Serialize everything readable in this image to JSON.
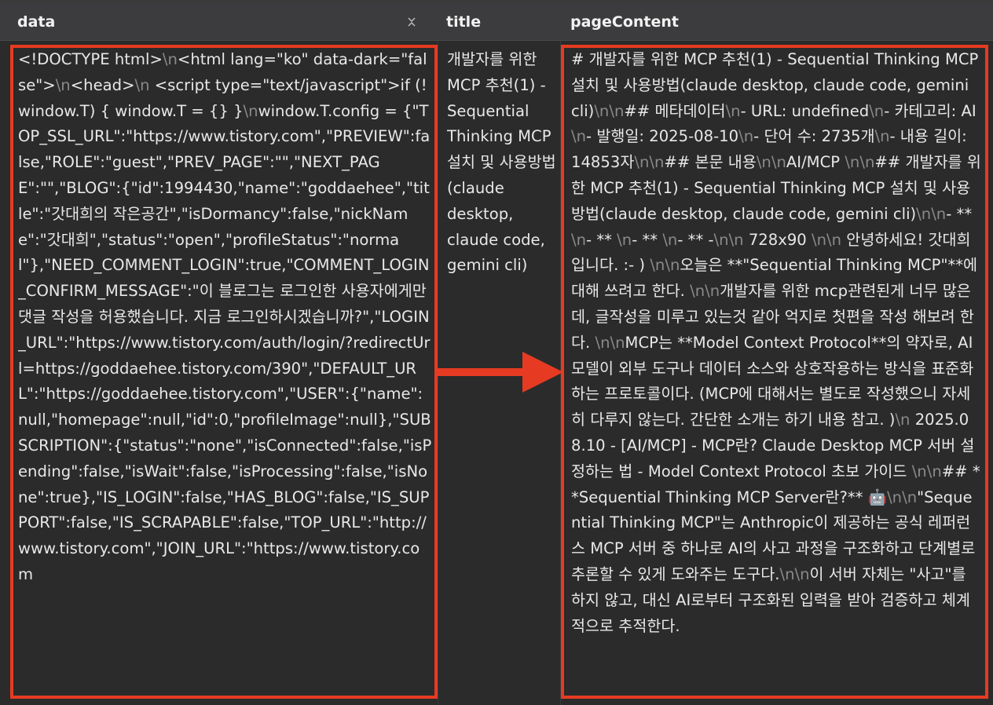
{
  "columns": {
    "data": "data",
    "title": "title",
    "page_content": "pageContent"
  },
  "colors": {
    "highlight": "#e63b22",
    "background": "#2b2b2b",
    "header": "#3c3c3e"
  },
  "row": {
    "title": "개발자를 위한 MCP 추천(1) - Sequential Thinking MCP 설치 및 사용방법(claude desktop, claude code, gemini cli)",
    "data_segments": [
      "<!DOCTYPE html>",
      "<html lang=\"ko\" data-dark=\"false\">",
      "<head>",
      "                <script type=\"text/javascript\">if (!window.T) { window.T = {} }",
      "window.T.config = {\"TOP_SSL_URL\":\"https://www.tistory.com\",\"PREVIEW\":false,\"ROLE\":\"guest\",\"PREV_PAGE\":\"\",\"NEXT_PAGE\":\"\",\"BLOG\":{\"id\":1994430,\"name\":\"goddaehee\",\"title\":\"갓대희의 작은공간\",\"isDormancy\":false,\"nickName\":\"갓대희\",\"status\":\"open\",\"profileStatus\":\"normal\"},\"NEED_COMMENT_LOGIN\":true,\"COMMENT_LOGIN_CONFIRM_MESSAGE\":\"이 블로그는 로그인한 사용자에게만 댓글 작성을 허용했습니다. 지금 로그인하시겠습니까?\",\"LOGIN_URL\":\"https://www.tistory.com/auth/login/?redirectUrl=https://goddaehee.tistory.com/390\",\"DEFAULT_URL\":\"https://goddaehee.tistory.com\",\"USER\":{\"name\":null,\"homepage\":null,\"id\":0,\"profileImage\":null},\"SUBSCRIPTION\":{\"status\":\"none\",\"isConnected\":false,\"isPending\":false,\"isWait\":false,\"isProcessing\":false,\"isNone\":true},\"IS_LOGIN\":false,\"HAS_BLOG\":false,\"IS_SUPPORT\":false,\"IS_SCRAPABLE\":false,\"TOP_URL\":\"http://www.tistory.com\",\"JOIN_URL\":\"https://www.tistory.com"
    ],
    "page_segments": [
      "# 개발자를 위한 MCP 추천(1) - Sequential Thinking MCP 설치 및 사용방법(claude desktop, claude code, gemini cli)",
      "",
      "## 메타데이터",
      "- URL: undefined",
      "- 카테고리: AI",
      "- 발행일: 2025-08-10",
      "- 단어 수: 2735개",
      "- 내용 길이: 14853자",
      "",
      "## 본문 내용",
      "",
      "AI/MCP ",
      "",
      "## 개발자를 위한 MCP 추천(1) - Sequential Thinking MCP 설치 및 사용방법(claude desktop, claude code, gemini cli)",
      "",
      "- ** ",
      "- ** ",
      "- ** ",
      "- ** -",
      "",
      " 728x90 ",
      "",
      " 안녕하세요! 갓대희 입니다. :- ) ",
      "",
      "오늘은 **\"Sequential Thinking MCP\"**에 대해 쓰려고 한다. ",
      "",
      "개발자를 위한 mcp관련된게 너무 많은데, 글작성을 미루고 있는것 같아 억지로 첫편을 작성 해보려 한다. ",
      "",
      "MCP는 **Model Context Protocol**의 약자로, AI 모델이 외부 도구나 데이터 소스와 상호작용하는 방식을 표준화하는 프로토콜이다. (MCP에 대해서는 별도로 작성했으니 자세히 다루지 않는다. 간단한 소개는 하기 내용 참고. )",
      " 2025.08.10 - [AI/MCP] - MCP란? Claude Desktop MCP 서버 설정하는 법 - Model Context Protocol 초보 가이드 ",
      "",
      "## **Sequential Thinking MCP Server란?** 🤖",
      "",
      "\"Sequential Thinking MCP\"는 Anthropic이 제공하는 공식 레퍼런스 MCP 서버 중 하나로 AI의 사고 과정을 구조화하고 단계별로 추론할 수 있게 도와주는 도구다.",
      "",
      "이 서버 자체는 \"사고\"를 하지 않고, 대신 AI로부터 구조화된 입력을 받아 검증하고 체계적으로 추적한다."
    ]
  }
}
